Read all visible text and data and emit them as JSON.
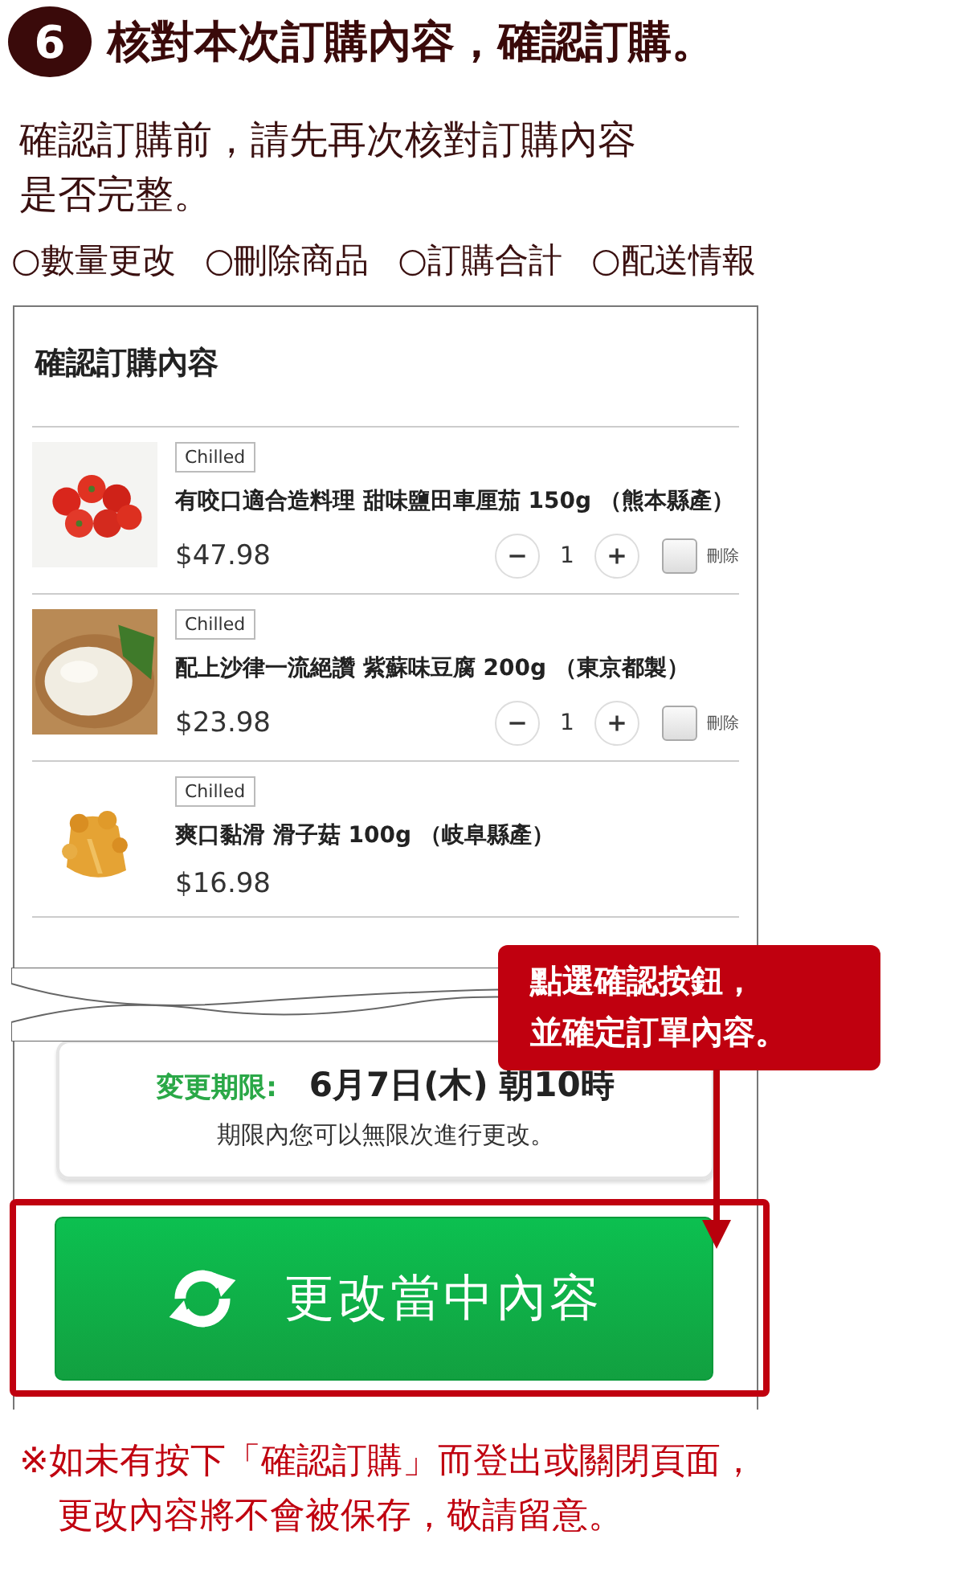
{
  "step": {
    "number": "6",
    "title": "核對本次訂購內容，確認訂購。"
  },
  "intro": "確認訂購前，請先再次核對訂購內容是否完整。",
  "checklist": [
    "○數量更改",
    "○刪除商品",
    "○訂購合計",
    "○配送情報"
  ],
  "order": {
    "title": "確認訂購內容",
    "items": [
      {
        "tag": "Chilled",
        "name": "有咬口適合造料理 甜味鹽田車厘茄 150g （熊本縣產）",
        "price": "$47.98",
        "quantity": "1",
        "delete_label": "刪除",
        "delete_checked": false
      },
      {
        "tag": "Chilled",
        "name": "配上沙律一流絕讚 紫蘇味豆腐 200g （東京都製）",
        "price": "$23.98",
        "quantity": "1",
        "delete_label": "刪除",
        "delete_checked": false
      },
      {
        "tag": "Chilled",
        "name": "爽口黏滑 滑子菇 100g （岐阜縣產）",
        "price": "$16.98"
      }
    ]
  },
  "deadline": {
    "label": "変更期限:",
    "value": "6月7日(木) 朝10時",
    "note": "期限內您可以無限次進行更改。"
  },
  "button": {
    "label": "更改當中內容"
  },
  "callout": [
    "點選確認按鈕，",
    "並確定訂單內容。"
  ],
  "note": "※如未有按下「確認訂購」而登出或關閉頁面，更改內容將不會被保存，敬請留意。"
}
